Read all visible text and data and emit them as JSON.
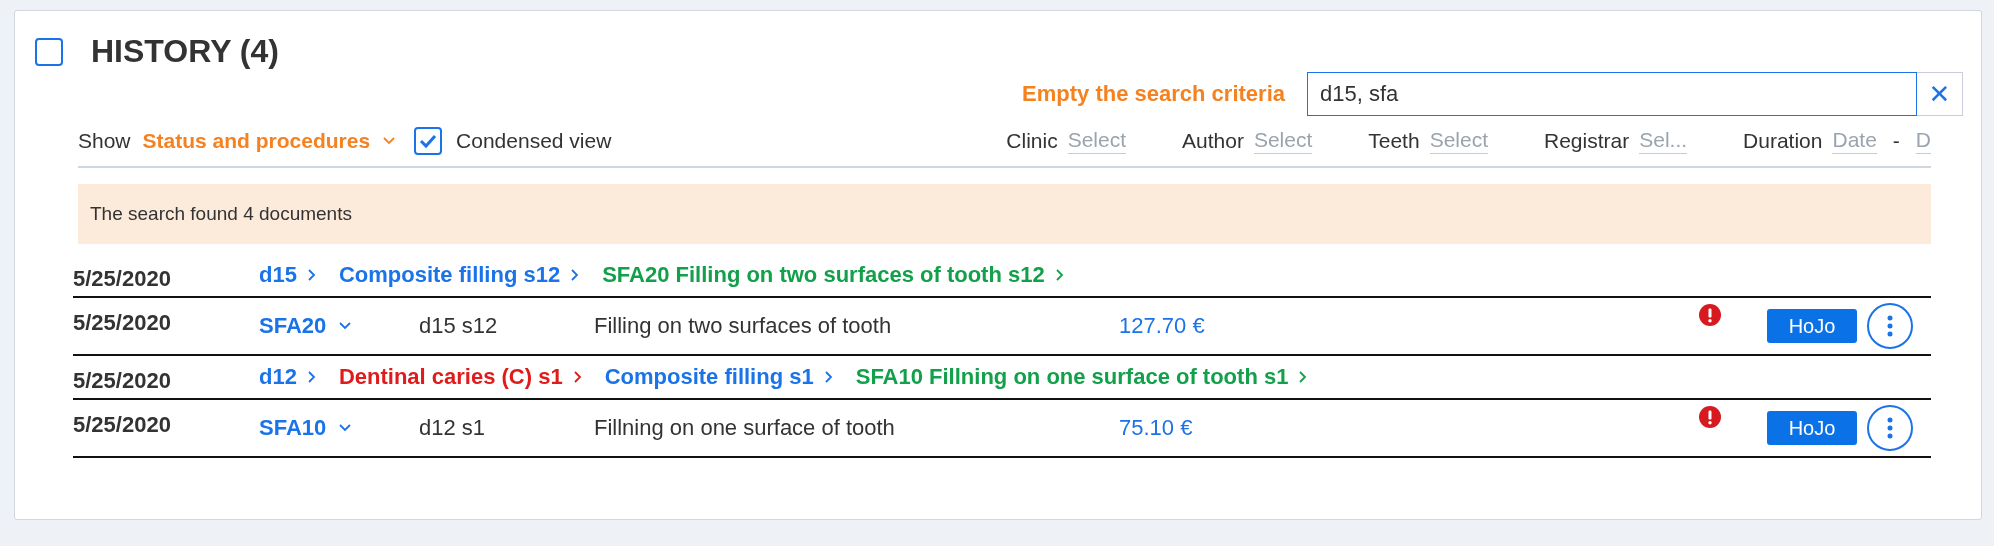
{
  "header": {
    "title": "HISTORY (4)",
    "checked": false
  },
  "search": {
    "clear_label": "Empty the search criteria",
    "value": "d15, sfa",
    "clear_icon": "✕"
  },
  "toolbar": {
    "show_label": "Show",
    "show_value": "Status and procedures",
    "condensed": {
      "label": "Condensed view",
      "checked": true
    },
    "filters": [
      {
        "kind": "select",
        "label": "Clinic",
        "placeholder": "Select"
      },
      {
        "kind": "select",
        "label": "Author",
        "placeholder": "Select"
      },
      {
        "kind": "select",
        "label": "Teeth",
        "placeholder": "Select"
      },
      {
        "kind": "select",
        "label": "Registrar",
        "placeholder": "Sel..."
      },
      {
        "kind": "range",
        "label": "Duration",
        "placeholder": "Date",
        "separator": "-",
        "placeholder_end": "D"
      }
    ]
  },
  "notice": "The search found 4 documents",
  "rows": [
    {
      "kind": "path",
      "date": "5/25/2020",
      "crumbs": [
        {
          "text": "d15",
          "color": "#1a73e8"
        },
        {
          "text": "Composite filling s12",
          "color": "#1a73e8"
        },
        {
          "text": "SFA20 Filling on two surfaces of tooth s12",
          "color": "#13a04a"
        }
      ]
    },
    {
      "kind": "item",
      "date": "5/25/2020",
      "code": "SFA20",
      "teeth": "d15 s12",
      "description": "Filling on two surfaces of tooth",
      "price": "127.70 €",
      "warning": true,
      "button": "HoJo"
    },
    {
      "kind": "path",
      "date": "5/25/2020",
      "crumbs": [
        {
          "text": "d12",
          "color": "#1a73e8"
        },
        {
          "text": "Dentinal caries (C) s1",
          "color": "#e01b1b"
        },
        {
          "text": "Composite filling s1",
          "color": "#1a73e8"
        },
        {
          "text": "SFA10 Fillning on one surface of tooth s1",
          "color": "#13a04a"
        }
      ]
    },
    {
      "kind": "item",
      "date": "5/25/2020",
      "code": "SFA10",
      "teeth": "d12 s1",
      "description": "Fillning on one surface of tooth",
      "price": "75.10 €",
      "warning": true,
      "button": "HoJo"
    }
  ]
}
